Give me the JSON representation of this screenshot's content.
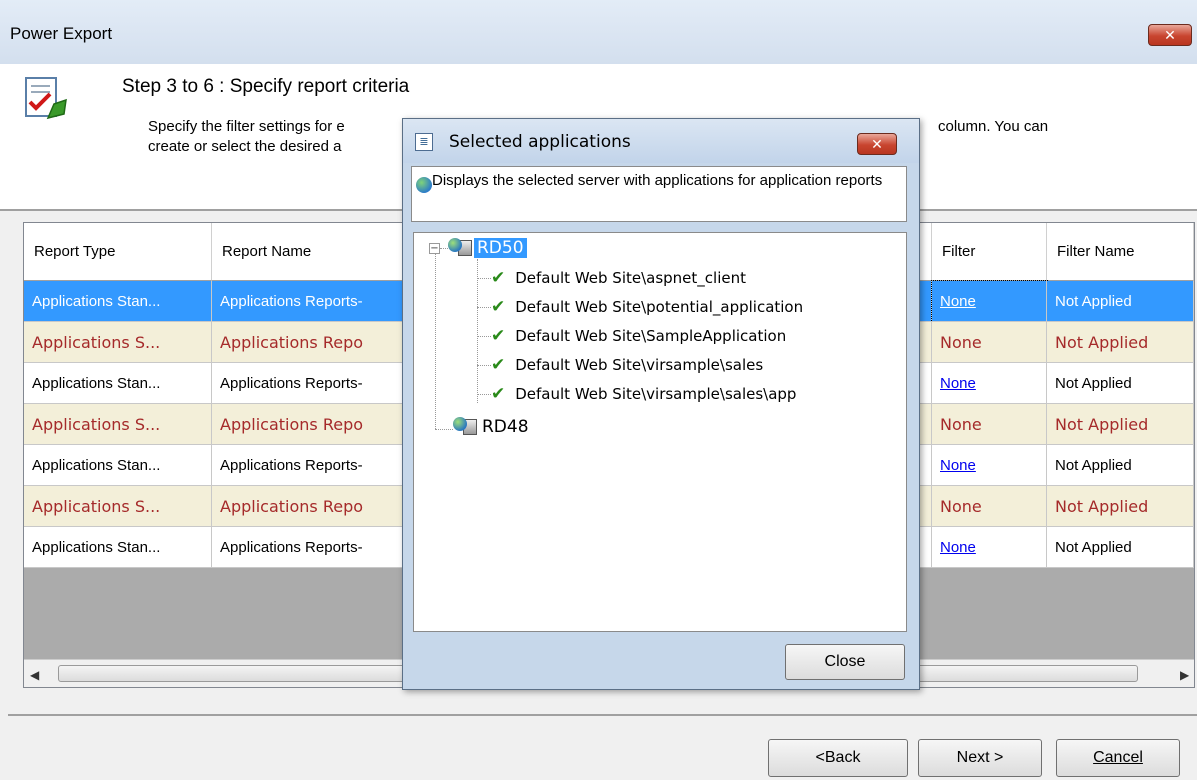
{
  "window": {
    "title": "Power Export",
    "close_glyph": "✕"
  },
  "header": {
    "icon": "report-check-icon",
    "step_title": "Step 3 to 6 : Specify report criteria",
    "description_line1": "Specify the filter settings for e",
    "description_line1_tail": "column. You can",
    "description_line2": "create or select the desired a"
  },
  "grid": {
    "columns": [
      "Report Type",
      "Report Name",
      "Filter",
      "Filter Name"
    ],
    "rows": [
      {
        "style": "selected",
        "report_type": "Applications Stan...",
        "report_name": "Applications Reports-",
        "filter": "None",
        "filter_link": true,
        "filter_name": "Not Applied"
      },
      {
        "style": "alt",
        "report_type": "Applications S...",
        "report_name": "Applications Repo",
        "filter": "None",
        "filter_link": false,
        "filter_name": "Not Applied"
      },
      {
        "style": "normal",
        "report_type": "Applications Stan...",
        "report_name": "Applications Reports-",
        "filter": "None",
        "filter_link": true,
        "filter_name": "Not Applied"
      },
      {
        "style": "alt",
        "report_type": "Applications S...",
        "report_name": "Applications Repo",
        "filter": "None",
        "filter_link": false,
        "filter_name": "Not Applied"
      },
      {
        "style": "normal",
        "report_type": "Applications Stan...",
        "report_name": "Applications Reports-",
        "filter": "None",
        "filter_link": true,
        "filter_name": "Not Applied"
      },
      {
        "style": "alt",
        "report_type": "Applications S...",
        "report_name": "Applications Repo",
        "filter": "None",
        "filter_link": false,
        "filter_name": "Not Applied"
      },
      {
        "style": "normal",
        "report_type": "Applications Stan...",
        "report_name": "Applications Reports-",
        "filter": "None",
        "filter_link": true,
        "filter_name": "Not Applied"
      }
    ],
    "scroll_left_glyph": "◀",
    "scroll_right_glyph": "▶"
  },
  "footer": {
    "back_label": "<Back",
    "next_label": "Next >",
    "cancel_label": "Cancel"
  },
  "dialog": {
    "title": "Selected applications",
    "icon_glyph": "≣",
    "description": "Displays the selected server with applications for application reports",
    "tree": {
      "servers": [
        {
          "name": "RD50",
          "expanded": true,
          "selected": true,
          "applications": [
            "Default Web Site\\aspnet_client",
            "Default Web Site\\potential_application",
            "Default Web Site\\SampleApplication",
            "Default Web Site\\virsample\\sales",
            "Default Web Site\\virsample\\sales\\app"
          ]
        },
        {
          "name": "RD48",
          "expanded": false,
          "selected": false,
          "applications": []
        }
      ],
      "expander_glyph": "−",
      "check_glyph": "✔"
    },
    "close_label": "Close"
  },
  "colors": {
    "selection": "#3399ff",
    "alt_row_bg": "#f3efd9",
    "alt_row_text": "#a52a2a",
    "link": "#0000ee"
  }
}
